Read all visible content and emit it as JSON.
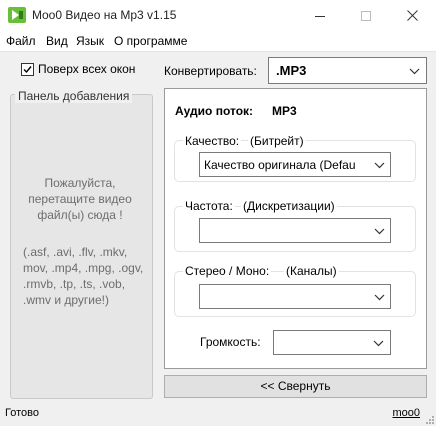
{
  "window": {
    "title": "Moo0 Видео на Mp3 v1.15",
    "app_icon": "moo0-app-icon",
    "controls": [
      "minimize-icon",
      "maximize-icon",
      "close-icon"
    ]
  },
  "menu": {
    "items": [
      "Файл",
      "Вид",
      "Язык",
      "О программе"
    ]
  },
  "always_on_top": {
    "label": "Поверх всех окон",
    "checked": true
  },
  "add_panel": {
    "title": "Панель добавления",
    "drop_hint": "Пожалуйста, перетащите видео файл(ы) сюда !",
    "formats": "(.asf, .avi, .flv, .mkv, mov, .mp4, .mpg, .ogv, .rmvb, .tp, .ts, .vob, .wmv и другие!)"
  },
  "convert": {
    "label": "Конвертировать:",
    "selected": ".MP3"
  },
  "audio": {
    "title": "Аудио поток:",
    "value": "MP3",
    "quality": {
      "label": "Качество:",
      "sublabel": "(Битрейт)",
      "selected": "Качество оригинала  (Defau"
    },
    "frequency": {
      "label": "Частота:",
      "sublabel": "(Дискретизации)",
      "selected": ""
    },
    "channels": {
      "label": "Стерео / Моно:",
      "sublabel": "(Каналы)",
      "selected": ""
    },
    "volume": {
      "label": "Громкость:",
      "selected": ""
    }
  },
  "collapse_button": "<< Свернуть",
  "status": {
    "text": "Готово",
    "link": "moo0"
  },
  "colors": {
    "window_bg": "#f0f0f0",
    "panel_bg": "#e6e6e6",
    "hint_text": "#6d6d6d",
    "button_bg": "#e1e1e1",
    "icon_green": "#6abf3a"
  }
}
